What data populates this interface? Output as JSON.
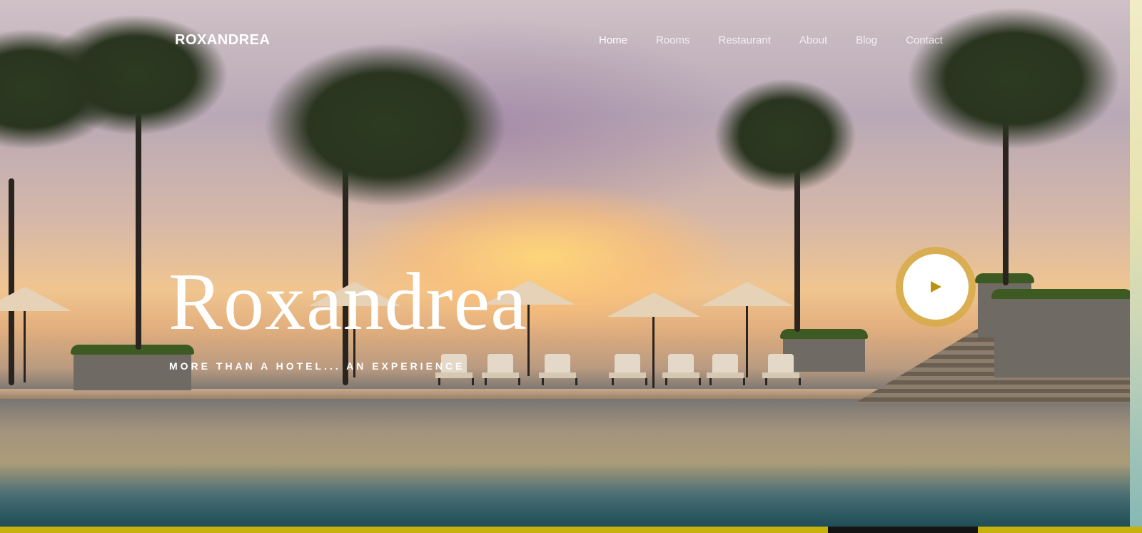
{
  "brand": {
    "name": "ROXANDREA"
  },
  "nav": {
    "items": [
      {
        "label": "Home",
        "active": true
      },
      {
        "label": "Rooms"
      },
      {
        "label": "Restaurant"
      },
      {
        "label": "About"
      },
      {
        "label": "Blog"
      },
      {
        "label": "Contact"
      }
    ]
  },
  "hero": {
    "title": "Roxandrea",
    "subtitle": "MORE THAN A HOTEL... AN EXPERIENCE"
  },
  "icons": {
    "play": "play-icon"
  },
  "colors": {
    "accent": "#c6b10d",
    "play_ring": "#d7aa46",
    "play_triangle": "#b8930f",
    "text": "#ffffff"
  }
}
